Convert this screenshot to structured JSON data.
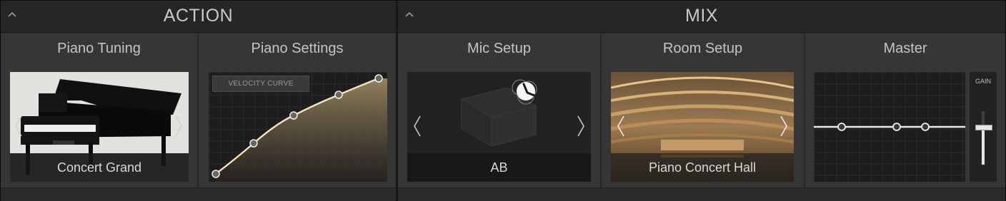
{
  "action": {
    "title": "ACTION",
    "piano_tuning": {
      "title": "Piano Tuning",
      "preset": "Concert Grand"
    },
    "piano_settings": {
      "title": "Piano Settings",
      "curve_label": "VELOCITY CURVE"
    }
  },
  "mix": {
    "title": "MIX",
    "mic_setup": {
      "title": "Mic Setup",
      "preset": "AB"
    },
    "room_setup": {
      "title": "Room Setup",
      "preset": "Piano Concert Hall"
    },
    "master": {
      "title": "Master",
      "gain_label": "GAIN"
    }
  },
  "icons": [
    "chevron-up-icon",
    "chevron-left-icon",
    "chevron-right-icon",
    "mic-polar-icon"
  ],
  "colors": {
    "accent": "#f3e3c2",
    "curve_fill": "#8a7a58",
    "eq_line": "#e8e8e8"
  }
}
